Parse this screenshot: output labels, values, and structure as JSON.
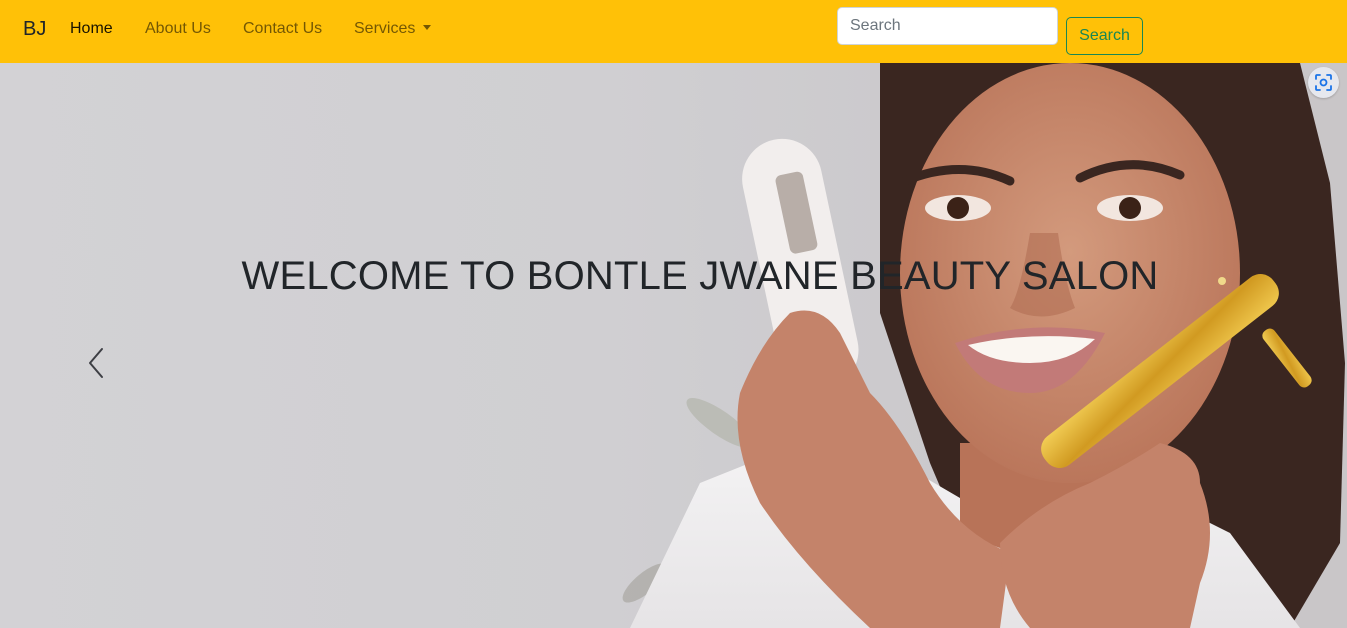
{
  "navbar": {
    "brand": "BJ",
    "links": [
      {
        "label": "Home",
        "active": true
      },
      {
        "label": "About Us",
        "active": false
      },
      {
        "label": "Contact Us",
        "active": false
      },
      {
        "label": "Services",
        "active": false,
        "dropdown": true
      }
    ],
    "search": {
      "placeholder": "Search",
      "value": "",
      "button_label": "Search"
    }
  },
  "hero": {
    "heading": "WELCOME TO BONTLE JWANE BEAUTY SALON",
    "prev_icon": "chevron-left-icon"
  },
  "overlay": {
    "lens_icon": "visual-search-icon"
  },
  "colors": {
    "navbar_bg": "#ffc107",
    "search_button": "#198754",
    "heading_text": "#212529",
    "hero_bg": "#d1d0d3"
  }
}
